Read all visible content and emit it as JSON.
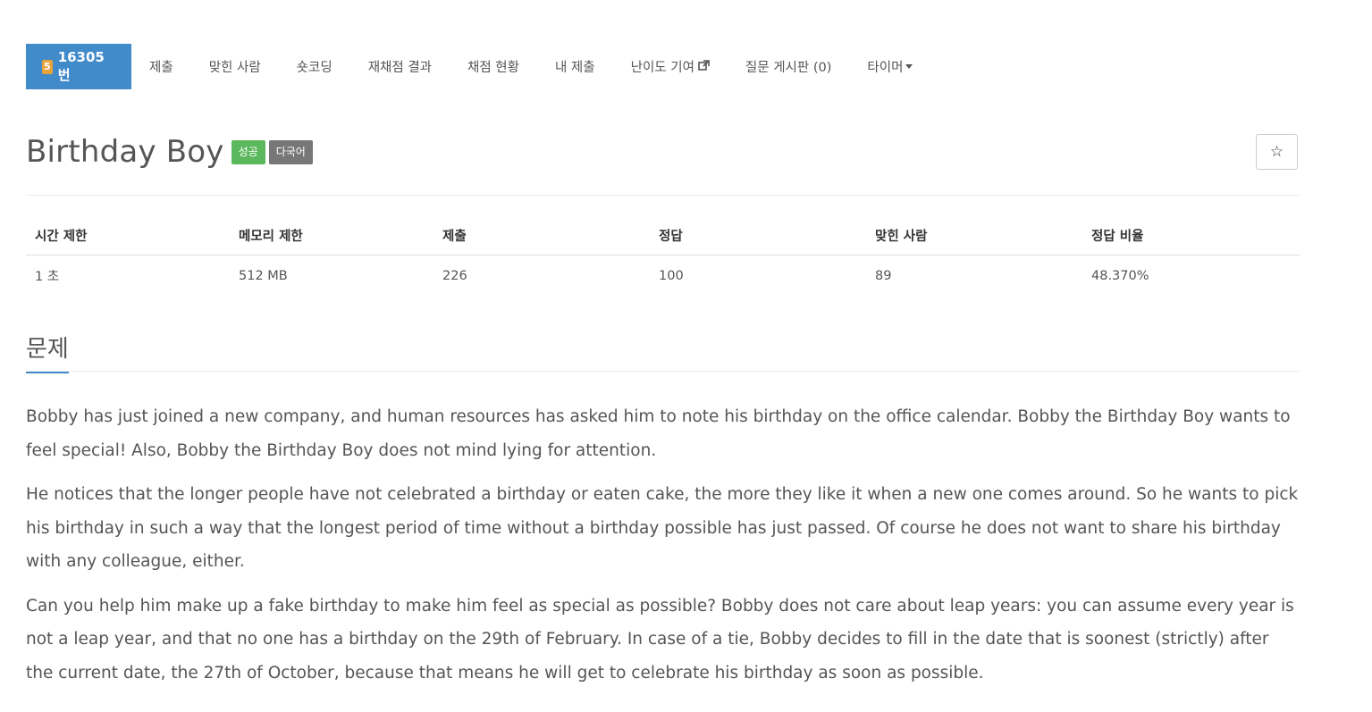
{
  "nav": {
    "tier": "5",
    "problem_id": "16305번",
    "items": [
      "제출",
      "맞힌 사람",
      "숏코딩",
      "재채점 결과",
      "채점 현황",
      "내 제출",
      "난이도 기여",
      "질문 게시판 (0)",
      "타이머"
    ]
  },
  "problem": {
    "title": "Birthday Boy",
    "labels": [
      "성공",
      "다국어"
    ],
    "star_icon": "☆"
  },
  "limits": {
    "headers": [
      "시간 제한",
      "메모리 제한",
      "제출",
      "정답",
      "맞힌 사람",
      "정답 비율"
    ],
    "values": [
      "1 초",
      "512 MB",
      "226",
      "100",
      "89",
      "48.370%"
    ]
  },
  "section": {
    "title": "문제"
  },
  "description": [
    "Bobby has just joined a new company, and human resources has asked him to note his birthday on the office calendar. Bobby the Birthday Boy wants to feel special! Also, Bobby the Birthday Boy does not mind lying for attention.",
    "He notices that the longer people have not celebrated a birthday or eaten cake, the more they like it when a new one comes around. So he wants to pick his birthday in such a way that the longest period of time without a birthday possible has just passed. Of course he does not want to share his birthday with any colleague, either.",
    "Can you help him make up a fake birthday to make him feel as special as possible? Bobby does not care about leap years: you can assume every year is not a leap year, and that no one has a birthday on the 29th of February. In case of a tie, Bobby decides to fill in the date that is soonest (strictly) after the current date, the 27th of October, because that means he will get to celebrate his birthday as soon as possible."
  ],
  "colors": {
    "accent": "#428bca",
    "success": "#5cb85c",
    "default": "#777777",
    "tier": "#e8a33a"
  }
}
